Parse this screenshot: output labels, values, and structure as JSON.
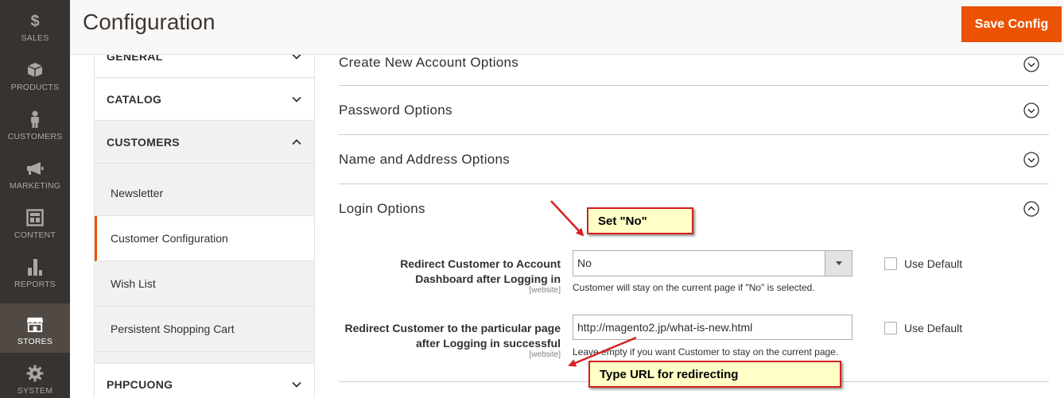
{
  "nav": {
    "items": [
      {
        "label": "SALES",
        "icon": "dollar-icon"
      },
      {
        "label": "PRODUCTS",
        "icon": "cube-icon"
      },
      {
        "label": "CUSTOMERS",
        "icon": "person-icon"
      },
      {
        "label": "MARKETING",
        "icon": "megaphone-icon"
      },
      {
        "label": "CONTENT",
        "icon": "layout-icon"
      },
      {
        "label": "REPORTS",
        "icon": "bar-chart-icon"
      },
      {
        "label": "STORES",
        "icon": "storefront-icon"
      },
      {
        "label": "SYSTEM",
        "icon": "gear-icon"
      }
    ],
    "active": "STORES"
  },
  "header": {
    "title": "Configuration",
    "save_label": "Save Config"
  },
  "tabs": {
    "general": "GENERAL",
    "catalog": "CATALOG",
    "customers": "CUSTOMERS",
    "items": [
      "Newsletter",
      "Customer Configuration",
      "Wish List",
      "Persistent Shopping Cart"
    ],
    "active_item": "Customer Configuration",
    "phpcuong": "PHPCUONG"
  },
  "sections": [
    {
      "title": "Create New Account Options",
      "expanded": false
    },
    {
      "title": "Password Options",
      "expanded": false
    },
    {
      "title": "Name and Address Options",
      "expanded": false
    },
    {
      "title": "Login Options",
      "expanded": true
    }
  ],
  "login_options": {
    "redirect_dashboard": {
      "label_line1": "Redirect Customer to Account",
      "label_line2": "Dashboard after Logging in",
      "scope": "[website]",
      "value": "No",
      "note": "Customer will stay on the current page if \"No\" is selected.",
      "use_default": "Use Default"
    },
    "redirect_url": {
      "label_line1": "Redirect Customer to the particular page",
      "label_line2": "after Logging in successful",
      "scope": "[website]",
      "value": "http://magento2.jp/what-is-new.html",
      "note": "Leave empty if you want Customer to stay on the current page.",
      "use_default": "Use Default"
    }
  },
  "annotations": {
    "set_no": "Set \"No\"",
    "type_url": "Type URL for redirecting",
    "color_border": "#d62020",
    "color_fill": "#ffffc6"
  },
  "colors": {
    "accent": "#eb5202",
    "nav_bg": "#373330",
    "nav_active": "#514943"
  }
}
